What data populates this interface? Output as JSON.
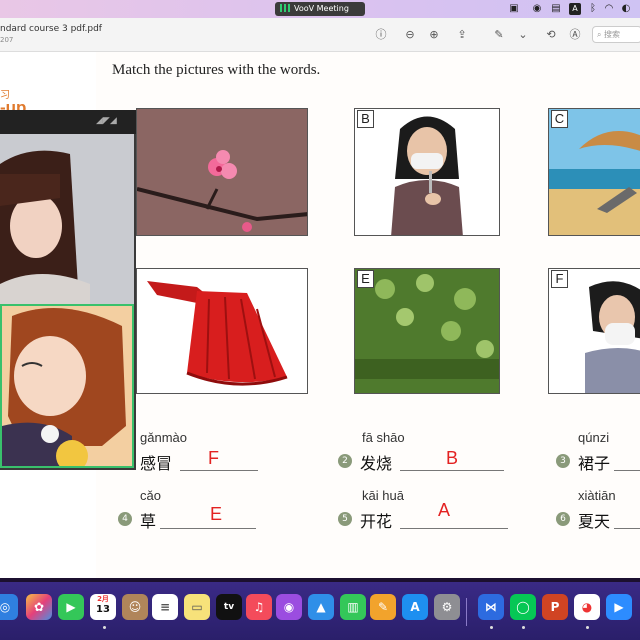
{
  "menubar": {
    "meeting_label": "VooV Meeting",
    "input_badge": "A"
  },
  "viewer": {
    "title": "ndard course 3 pdf.pdf",
    "subtitle": "207",
    "search_placeholder": "搜索"
  },
  "left_pane": {
    "warmup_top": "习",
    "warmup_label": "-up"
  },
  "exercise": {
    "heading": "Match the pictures with the words.",
    "pictures": [
      {
        "letter": "",
        "subject": "plum blossom"
      },
      {
        "letter": "B",
        "subject": "woman with thermometer"
      },
      {
        "letter": "C",
        "subject": "beach"
      },
      {
        "letter": "",
        "subject": "red skirt"
      },
      {
        "letter": "E",
        "subject": "grass"
      },
      {
        "letter": "F",
        "subject": "woman with cold"
      }
    ],
    "words": [
      {
        "num": "",
        "pinyin": "gǎnmào",
        "hanzi": "感冒",
        "answer": "F"
      },
      {
        "num": "2",
        "pinyin": "fā shāo",
        "hanzi": "发烧",
        "answer": "B"
      },
      {
        "num": "3",
        "pinyin": "qúnzi",
        "hanzi": "裙子",
        "answer": ""
      },
      {
        "num": "4",
        "pinyin": "cǎo",
        "hanzi": "草",
        "answer": "E"
      },
      {
        "num": "5",
        "pinyin": "kāi huā",
        "hanzi": "开花",
        "answer": "A"
      },
      {
        "num": "6",
        "pinyin": "xiàtiān",
        "hanzi": "夏天",
        "answer": ""
      }
    ]
  },
  "dock": {
    "calendar_month": "2月",
    "calendar_day": "13",
    "tv_label": "tv"
  },
  "colors": {
    "answer": "#e32222",
    "accent": "#e07a2e",
    "video_border": "#39c16c"
  }
}
